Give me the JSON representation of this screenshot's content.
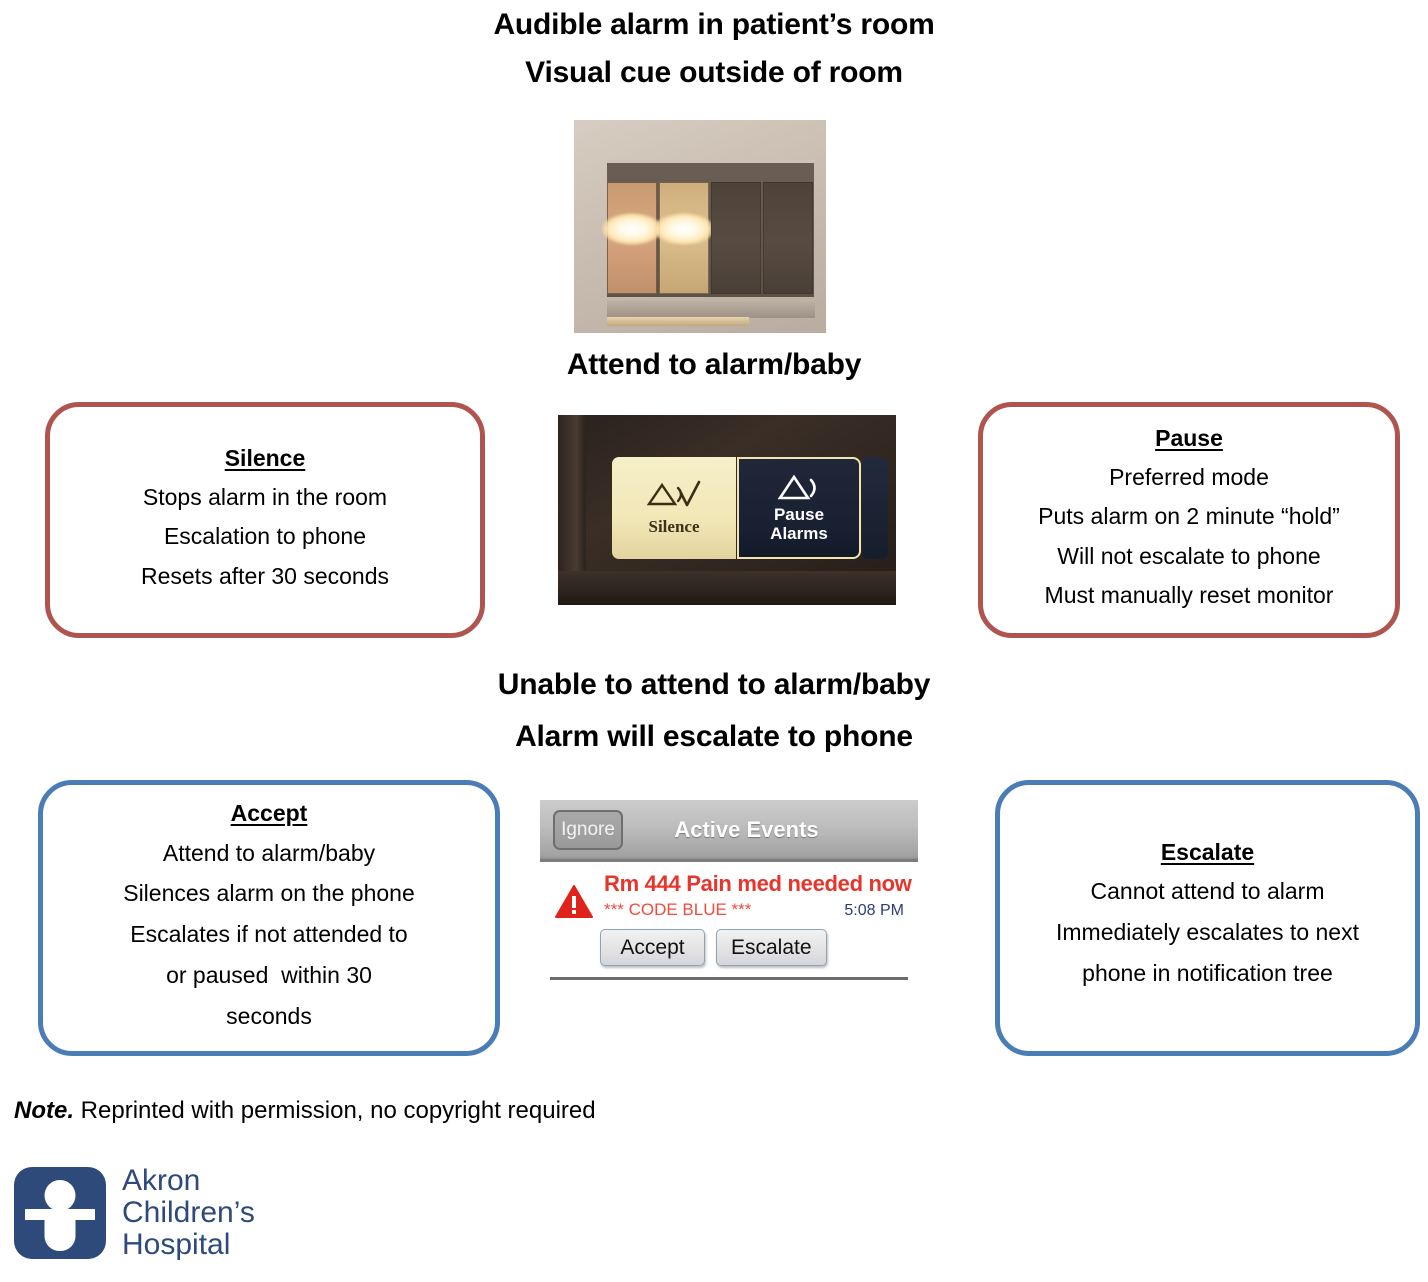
{
  "headings": {
    "audible": "Audible alarm in patient’s room",
    "visual": "Visual cue outside of room",
    "attend": "Attend to alarm/baby",
    "unable": "Unable to attend to alarm/baby",
    "escalate_phone": "Alarm will escalate to phone"
  },
  "boxes": {
    "silence": {
      "title": "Silence",
      "border_color": "#b0544f",
      "lines": [
        "Stops alarm in the room",
        "Escalation to phone",
        "Resets after 30 seconds"
      ]
    },
    "pause": {
      "title": "Pause",
      "border_color": "#b0544f",
      "lines": [
        "Preferred mode",
        "Puts alarm on 2 minute “hold”",
        "Will not escalate to phone",
        "Must manually reset monitor"
      ]
    },
    "accept": {
      "title": "Accept",
      "border_color": "#4a7cb5",
      "lines": [
        "Attend to alarm/baby",
        "Silences alarm on the phone",
        "Escalates if not attended to",
        "or paused  within 30",
        "seconds"
      ]
    },
    "escalate": {
      "title": "Escalate",
      "border_color": "#4a7cb5",
      "lines": [
        "Cannot attend to alarm",
        "Immediately escalates to next",
        "phone in notification tree"
      ]
    }
  },
  "monitor_photo": {
    "silence_label": "Silence",
    "pause_label_line1": "Pause",
    "pause_label_line2": "Alarms",
    "silence_icon": "alarm-triangle-check-icon",
    "pause_icon": "alarm-triangle-sound-icon"
  },
  "phone_photo": {
    "ignore_button": "Ignore",
    "title": "Active Events",
    "alert_icon": "warning-triangle-icon",
    "alert_main": "Rm 444 Pain med needed now",
    "alert_sub": "*** CODE BLUE ***",
    "alert_time": "5:08 PM",
    "accept_button": "Accept",
    "escalate_button": "Escalate",
    "alert_color": "#e8342a",
    "time_color": "#2b3f73"
  },
  "note": {
    "prefix": "Note.",
    "text": " Reprinted with permission, no copyright required"
  },
  "logo": {
    "line1": "Akron",
    "line2": "Children’s",
    "line3": "Hospital",
    "color": "#2d4a7a",
    "mark_icon": "child-figure-icon"
  }
}
